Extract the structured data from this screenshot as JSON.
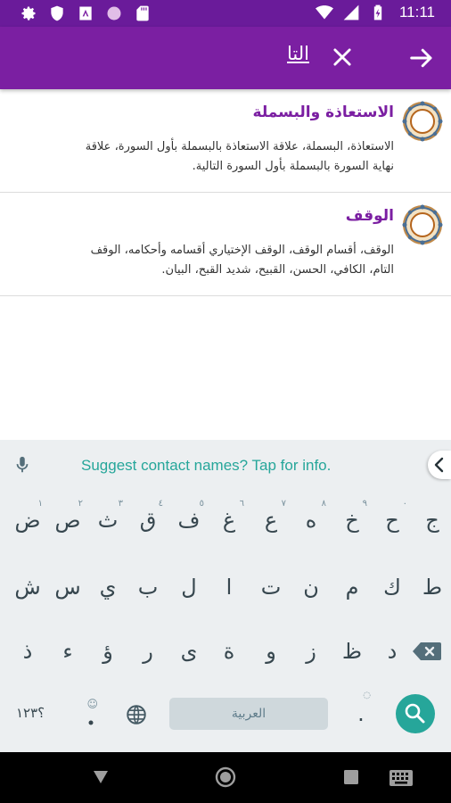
{
  "status_bar": {
    "time": "11:11",
    "left_icons": [
      "gear-icon",
      "shield-icon",
      "app-icon",
      "circle-icon",
      "sd-card-icon"
    ],
    "right_icons": [
      "wifi-icon",
      "signal-icon",
      "battery-charging-icon"
    ]
  },
  "app_bar": {
    "search_text": "التا",
    "clear_icon": "close-icon",
    "forward_icon": "arrow-forward-icon"
  },
  "results": [
    {
      "title": "الاستعاذة والبسملة",
      "desc_line1": "الاستعاذة، البسملة، علاقة الاستعاذة بالبسملة بأول السورة، علاقة",
      "desc_line2": "نهاية السورة بالبسملة بأول السورة التالية."
    },
    {
      "title": "الوقف",
      "desc_line1": "الوقف، أقسام الوقف، الوقف الإختياري أقسامه وأحكامه، الوقف",
      "desc_line2": "التام، الكافي، الحسن، القبيح، شديد القبح، البيان."
    }
  ],
  "keyboard": {
    "suggestion": "Suggest contact names? Tap for info.",
    "row1": [
      {
        "c": "ض",
        "h": "١"
      },
      {
        "c": "ص",
        "h": "٢"
      },
      {
        "c": "ث",
        "h": "٣"
      },
      {
        "c": "ق",
        "h": "٤"
      },
      {
        "c": "ف",
        "h": "٥"
      },
      {
        "c": "غ",
        "h": "٦"
      },
      {
        "c": "ع",
        "h": "٧"
      },
      {
        "c": "ه",
        "h": "٨"
      },
      {
        "c": "خ",
        "h": "٩"
      },
      {
        "c": "ح",
        "h": "٠"
      },
      {
        "c": "ج",
        "h": ""
      }
    ],
    "row2": [
      "ش",
      "س",
      "ي",
      "ب",
      "ل",
      "ا",
      "ت",
      "ن",
      "م",
      "ك",
      "ط"
    ],
    "row3": [
      "ذ",
      "ء",
      "ؤ",
      "ر",
      "ى",
      "ة",
      "و",
      "ز",
      "ظ",
      "د"
    ],
    "numbers_key": "؟١٢٣",
    "space_label": "العربية",
    "period_key": ".",
    "emoji_hint": "☺",
    "period_hint": "◌"
  }
}
